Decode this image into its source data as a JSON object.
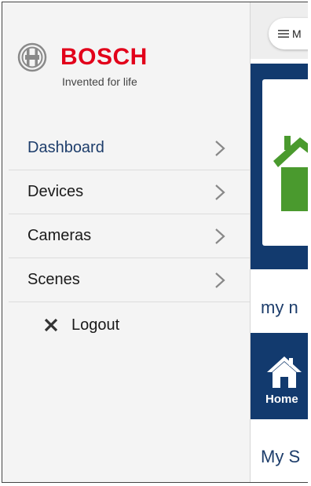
{
  "brand": {
    "name": "BOSCH",
    "tagline": "Invented for life",
    "logo_icon": "bosch-armature-logo",
    "color": "#e2001a"
  },
  "menu": {
    "items": [
      {
        "label": "Dashboard",
        "active": true
      },
      {
        "label": "Devices",
        "active": false
      },
      {
        "label": "Cameras",
        "active": false
      },
      {
        "label": "Scenes",
        "active": false
      }
    ],
    "logout_label": "Logout",
    "logout_icon": "close-icon"
  },
  "background": {
    "menu_pill_text": "M",
    "my_text": "my n",
    "home_tab_label": "Home",
    "section_text": "My S"
  },
  "colors": {
    "navy": "#123a6e",
    "accent_text": "#1d3d6b",
    "house_green": "#4a9a2e"
  }
}
